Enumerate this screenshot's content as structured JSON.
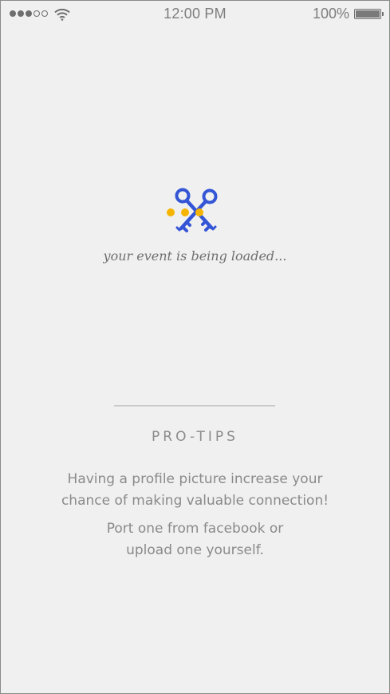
{
  "status_bar": {
    "signal_dots_filled": 3,
    "signal_dots_total": 5,
    "time": "12:00 PM",
    "battery_percent": "100%",
    "battery_level": 1.0,
    "icons": [
      "signal-dots-icon",
      "wifi-icon",
      "battery-icon"
    ]
  },
  "loader": {
    "icon": "crossed-keys-icon",
    "text": "your event is being loaded...",
    "colors": {
      "keys": "#3355d6",
      "dots": "#f5b400"
    }
  },
  "tips": {
    "heading": "PRO-TIPS",
    "tip_line_1": "Having a profile picture increase your",
    "tip_line_2": "chance of making valuable connection!",
    "tip_line_3": "Port one from facebook or",
    "tip_line_4": "upload one yourself."
  },
  "colors": {
    "background": "#f0f0f0",
    "text": "#8a8a8a",
    "divider": "#c9c9c9"
  }
}
